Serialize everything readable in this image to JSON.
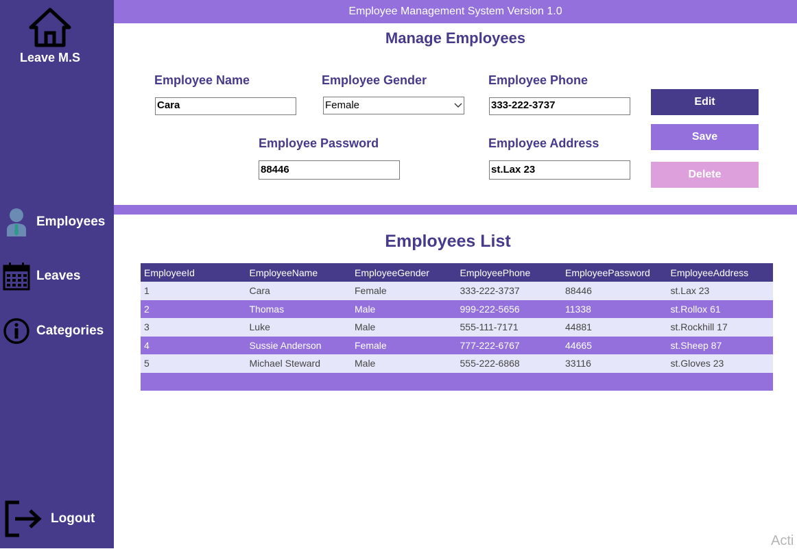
{
  "window_title": "Employee Management System Version 1.0",
  "sidebar": {
    "brand": "Leave M.S",
    "items": [
      {
        "label": "Employees",
        "icon": "employee-icon"
      },
      {
        "label": "Leaves",
        "icon": "calendar-icon"
      },
      {
        "label": "Categories",
        "icon": "info-icon"
      }
    ],
    "logout": "Logout"
  },
  "form": {
    "title": "Manage Employees",
    "name_label": "Employee Name",
    "name_value": "Cara",
    "gender_label": "Employee Gender",
    "gender_value": "Female",
    "phone_label": "Employee Phone",
    "phone_value": "333-222-3737",
    "password_label": "Employee Password",
    "password_value": "88446",
    "address_label": "Employee Address",
    "address_value": "st.Lax 23"
  },
  "buttons": {
    "edit": "Edit",
    "save": "Save",
    "delete": "Delete"
  },
  "list": {
    "title": "Employees List",
    "columns": [
      "EmployeeId",
      "EmployeeName",
      "EmployeeGender",
      "EmployeePhone",
      "EmployeePassword",
      "EmployeeAddress"
    ],
    "rows": [
      [
        "1",
        "Cara",
        "Female",
        "333-222-3737",
        "88446",
        "st.Lax 23"
      ],
      [
        "2",
        "Thomas",
        "Male",
        "999-222-5656",
        "11338",
        "st.Rollox 61"
      ],
      [
        "3",
        "Luke",
        "Male",
        "555-111-7171",
        "44881",
        "st.Rockhill 17"
      ],
      [
        "4",
        "Sussie Anderson",
        "Female",
        "777-222-6767",
        "44665",
        "st.Sheep 87"
      ],
      [
        "5",
        "Michael Steward",
        "Male",
        "555-222-6868",
        "33116",
        "st.Gloves 23"
      ]
    ]
  },
  "watermark": "Acti",
  "colors": {
    "sidebar": "#463a8a",
    "accent": "#9370db",
    "delete": "#dda0dd",
    "row_light": "#e6e6fa"
  }
}
